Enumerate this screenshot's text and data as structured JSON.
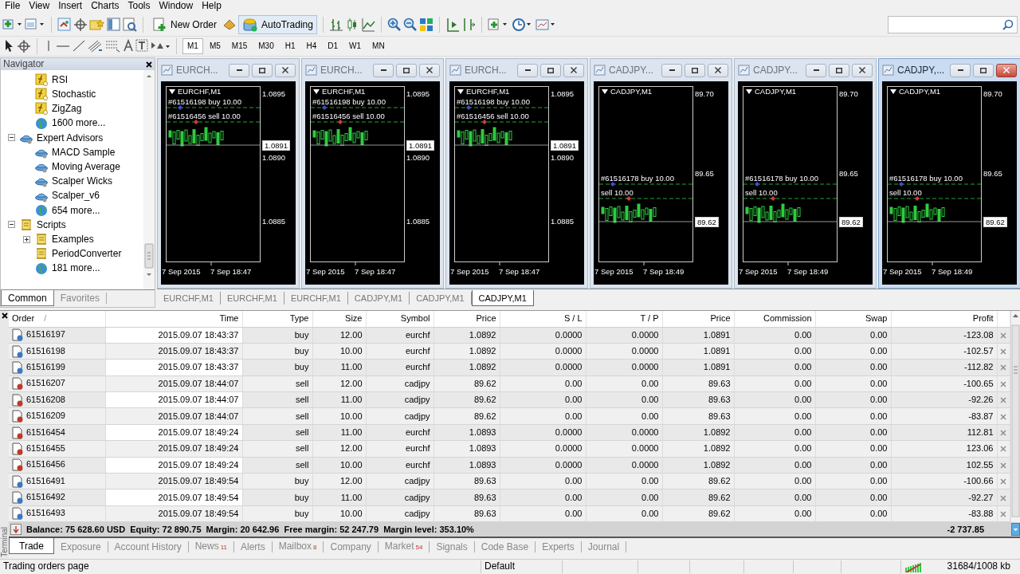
{
  "menu": [
    "File",
    "View",
    "Insert",
    "Charts",
    "Tools",
    "Window",
    "Help"
  ],
  "toolbar": {
    "buttons": [
      {
        "label": "New Order",
        "on": false
      },
      {
        "label": "AutoTrading",
        "on": true
      }
    ]
  },
  "timeframes": [
    {
      "label": "M1",
      "selected": true
    },
    {
      "label": "M5",
      "selected": false
    },
    {
      "label": "M15",
      "selected": false
    },
    {
      "label": "M30",
      "selected": false
    },
    {
      "label": "H1",
      "selected": false
    },
    {
      "label": "H4",
      "selected": false
    },
    {
      "label": "D1",
      "selected": false
    },
    {
      "label": "W1",
      "selected": false
    },
    {
      "label": "MN",
      "selected": false
    }
  ],
  "navigator": {
    "title": "Navigator",
    "tree": [
      {
        "children": [
          {
            "label": "RSI",
            "kind": "indicator"
          },
          {
            "label": "Stochastic",
            "kind": "indicator"
          },
          {
            "label": "ZigZag",
            "kind": "indicator"
          },
          {
            "label": "1600 more...",
            "kind": "more"
          }
        ]
      },
      {
        "label": "Expert Advisors",
        "kind": "expert",
        "expanded": true,
        "children": [
          {
            "label": "MACD Sample",
            "kind": "expert"
          },
          {
            "label": "Moving Average",
            "kind": "expert"
          },
          {
            "label": "Scalper Wicks",
            "kind": "expert"
          },
          {
            "label": "Scalper_v6",
            "kind": "expert"
          },
          {
            "label": "654 more...",
            "kind": "more"
          }
        ]
      },
      {
        "label": "Scripts",
        "kind": "script",
        "expanded": true,
        "children": [
          {
            "label": "Examples",
            "kind": "script",
            "expanded": false
          },
          {
            "label": "PeriodConverter",
            "kind": "script"
          },
          {
            "label": "181 more...",
            "kind": "more"
          }
        ]
      }
    ],
    "tabs": [
      {
        "label": "Common",
        "selected": true
      },
      {
        "label": "Favorites",
        "selected": false
      }
    ]
  },
  "chart_windows": [
    {
      "title": "EURCH...",
      "selected": false,
      "symbol": "EURCHF,M1",
      "prices": [
        {
          "text": "1.0895",
          "kind": "tick"
        },
        {
          "text": "1.0891",
          "kind": "current"
        },
        {
          "text": "1.0890",
          "kind": "tick"
        },
        {
          "text": "1.0885",
          "kind": "tick"
        }
      ],
      "orders": [
        "#61516198 buy 10.00",
        "#61516456 sell 10.00"
      ],
      "dates": [
        "7 Sep 2015",
        "7 Sep 18:47"
      ]
    },
    {
      "title": "EURCH...",
      "selected": false,
      "symbol": "EURCHF,M1",
      "prices": [
        {
          "text": "1.0895",
          "kind": "tick"
        },
        {
          "text": "1.0891",
          "kind": "current"
        },
        {
          "text": "1.0890",
          "kind": "tick"
        },
        {
          "text": "1.0885",
          "kind": "tick"
        }
      ],
      "orders": [
        "#61516198 buy 10.00",
        "#61516456 sell 10.00"
      ],
      "dates": [
        "7 Sep 2015",
        "7 Sep 18:47"
      ]
    },
    {
      "title": "EURCH...",
      "selected": false,
      "symbol": "EURCHF,M1",
      "prices": [
        {
          "text": "1.0895",
          "kind": "tick"
        },
        {
          "text": "1.0891",
          "kind": "current"
        },
        {
          "text": "1.0890",
          "kind": "tick"
        },
        {
          "text": "1.0885",
          "kind": "tick"
        }
      ],
      "orders": [
        "#61516198 buy 10.00",
        "#61516456 sell 10.00"
      ],
      "dates": [
        "7 Sep 2015",
        "7 Sep 18:47"
      ]
    },
    {
      "title": "CADJPY...",
      "selected": false,
      "symbol": "CADJPY,M1",
      "prices": [
        {
          "text": "89.70",
          "kind": "tick"
        },
        {
          "text": "89.65",
          "kind": "tick"
        },
        {
          "text": "89.62",
          "kind": "current"
        }
      ],
      "orders": [
        "#61516178 buy 10.00",
        "sell 10.00"
      ],
      "dates": [
        "7 Sep 2015",
        "7 Sep 18:49"
      ]
    },
    {
      "title": "CADJPY...",
      "selected": false,
      "symbol": "CADJPY,M1",
      "prices": [
        {
          "text": "89.70",
          "kind": "tick"
        },
        {
          "text": "89.65",
          "kind": "tick"
        },
        {
          "text": "89.62",
          "kind": "current"
        }
      ],
      "orders": [
        "#61516178 buy 10.00",
        "sell 10.00"
      ],
      "dates": [
        "7 Sep 2015",
        "7 Sep 18:49"
      ]
    },
    {
      "title": "CADJPY,...",
      "selected": true,
      "symbol": "CADJPY,M1",
      "prices": [
        {
          "text": "89.70",
          "kind": "tick"
        },
        {
          "text": "89.65",
          "kind": "tick"
        },
        {
          "text": "89.62",
          "kind": "current"
        }
      ],
      "orders": [
        "#61516178 buy 10.00",
        "sell 10.00"
      ],
      "dates": [
        "7 Sep 2015",
        "7 Sep 18:49"
      ]
    }
  ],
  "chart_tabs": [
    {
      "label": "EURCHF,M1",
      "selected": false
    },
    {
      "label": "EURCHF,M1",
      "selected": false
    },
    {
      "label": "EURCHF,M1",
      "selected": false
    },
    {
      "label": "CADJPY,M1",
      "selected": false
    },
    {
      "label": "CADJPY,M1",
      "selected": false
    },
    {
      "label": "CADJPY,M1",
      "selected": true
    }
  ],
  "terminal": {
    "title": "Terminal",
    "columns": [
      {
        "label": "Order",
        "sort_mark": "/"
      },
      {
        "label": "Time"
      },
      {
        "label": "Type"
      },
      {
        "label": "Size"
      },
      {
        "label": "Symbol"
      },
      {
        "label": "Price"
      },
      {
        "label": "S / L"
      },
      {
        "label": "T / P"
      },
      {
        "label": "Price"
      },
      {
        "label": "Commission"
      },
      {
        "label": "Swap"
      },
      {
        "label": "Profit"
      }
    ],
    "rows": [
      {
        "kind": "buy",
        "cells": [
          "61516197",
          "2015.09.07 18:43:37",
          "buy",
          "12.00",
          "eurchf",
          "1.0892",
          "0.0000",
          "0.0000",
          "1.0891",
          "0.00",
          "0.00",
          "-123.08"
        ]
      },
      {
        "kind": "buy",
        "cells": [
          "61516198",
          "2015.09.07 18:43:37",
          "buy",
          "10.00",
          "eurchf",
          "1.0892",
          "0.0000",
          "0.0000",
          "1.0891",
          "0.00",
          "0.00",
          "-102.57"
        ]
      },
      {
        "kind": "buy",
        "cells": [
          "61516199",
          "2015.09.07 18:43:37",
          "buy",
          "11.00",
          "eurchf",
          "1.0892",
          "0.0000",
          "0.0000",
          "1.0891",
          "0.00",
          "0.00",
          "-112.82"
        ]
      },
      {
        "kind": "sell",
        "cells": [
          "61516207",
          "2015.09.07 18:44:07",
          "sell",
          "12.00",
          "cadjpy",
          "89.62",
          "0.00",
          "0.00",
          "89.63",
          "0.00",
          "0.00",
          "-100.65"
        ]
      },
      {
        "kind": "sell",
        "cells": [
          "61516208",
          "2015.09.07 18:44:07",
          "sell",
          "11.00",
          "cadjpy",
          "89.62",
          "0.00",
          "0.00",
          "89.63",
          "0.00",
          "0.00",
          "-92.26"
        ]
      },
      {
        "kind": "sell",
        "cells": [
          "61516209",
          "2015.09.07 18:44:07",
          "sell",
          "10.00",
          "cadjpy",
          "89.62",
          "0.00",
          "0.00",
          "89.63",
          "0.00",
          "0.00",
          "-83.87"
        ]
      },
      {
        "kind": "sell",
        "cells": [
          "61516454",
          "2015.09.07 18:49:24",
          "sell",
          "11.00",
          "eurchf",
          "1.0893",
          "0.0000",
          "0.0000",
          "1.0892",
          "0.00",
          "0.00",
          "112.81"
        ]
      },
      {
        "kind": "sell",
        "cells": [
          "61516455",
          "2015.09.07 18:49:24",
          "sell",
          "12.00",
          "eurchf",
          "1.0893",
          "0.0000",
          "0.0000",
          "1.0892",
          "0.00",
          "0.00",
          "123.06"
        ]
      },
      {
        "kind": "sell",
        "cells": [
          "61516456",
          "2015.09.07 18:49:24",
          "sell",
          "10.00",
          "eurchf",
          "1.0893",
          "0.0000",
          "0.0000",
          "1.0892",
          "0.00",
          "0.00",
          "102.55"
        ]
      },
      {
        "kind": "buy",
        "cells": [
          "61516491",
          "2015.09.07 18:49:54",
          "buy",
          "12.00",
          "cadjpy",
          "89.63",
          "0.00",
          "0.00",
          "89.62",
          "0.00",
          "0.00",
          "-100.66"
        ]
      },
      {
        "kind": "buy",
        "cells": [
          "61516492",
          "2015.09.07 18:49:54",
          "buy",
          "11.00",
          "cadjpy",
          "89.63",
          "0.00",
          "0.00",
          "89.62",
          "0.00",
          "0.00",
          "-92.27"
        ]
      },
      {
        "kind": "buy",
        "cells": [
          "61516493",
          "2015.09.07 18:49:54",
          "buy",
          "10.00",
          "cadjpy",
          "89.63",
          "0.00",
          "0.00",
          "89.62",
          "0.00",
          "0.00",
          "-83.88"
        ]
      }
    ],
    "summary": "Balance: 75 628.60 USD  Equity: 72 890.75  Margin: 20 642.96  Free margin: 52 247.79  Margin level: 353.10%",
    "total": "-2 737.85",
    "tabs": [
      {
        "label": "Trade",
        "selected": true
      },
      {
        "label": "Exposure",
        "selected": false
      },
      {
        "label": "Account History",
        "selected": false
      },
      {
        "label": "News",
        "count": "11",
        "selected": false
      },
      {
        "label": "Alerts",
        "selected": false
      },
      {
        "label": "Mailbox",
        "count": "8",
        "selected": false
      },
      {
        "label": "Company",
        "selected": false
      },
      {
        "label": "Market",
        "count": "54",
        "selected": false
      },
      {
        "label": "Signals",
        "selected": false
      },
      {
        "label": "Code Base",
        "selected": false
      },
      {
        "label": "Experts",
        "selected": false
      },
      {
        "label": "Journal",
        "selected": false
      }
    ]
  },
  "status_bar": {
    "hint": "Trading orders page",
    "profile": "Default",
    "memory": "31684/1008 kb"
  }
}
